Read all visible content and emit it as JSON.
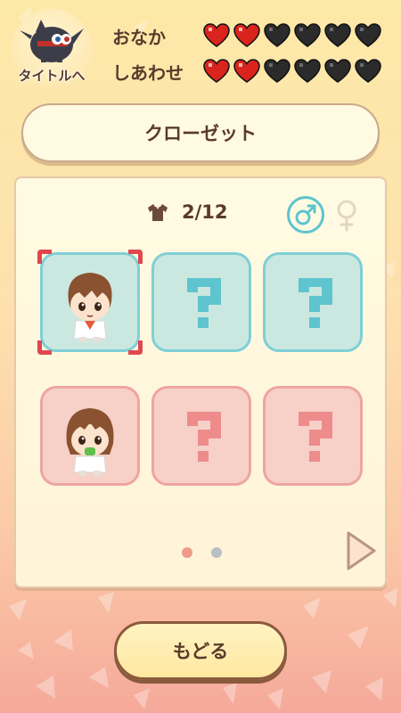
{
  "title_button": {
    "label": "タイトルへ",
    "icon": "bird-character-icon"
  },
  "stats": [
    {
      "label": "おなか",
      "filled": 2,
      "total": 6
    },
    {
      "label": "しあわせ",
      "filled": 2,
      "total": 6
    }
  ],
  "header": {
    "title": "クローゼット"
  },
  "closet": {
    "count": "2/12",
    "count_icon": "shirt-icon",
    "gender_selected": "male",
    "male_symbol": "♂",
    "female_symbol": "♀",
    "rows": [
      {
        "color": "blue",
        "slots": [
          {
            "state": "unlocked",
            "selected": true
          },
          {
            "state": "locked",
            "symbol": "?"
          },
          {
            "state": "locked",
            "symbol": "?"
          }
        ]
      },
      {
        "color": "pink",
        "slots": [
          {
            "state": "unlocked",
            "selected": false
          },
          {
            "state": "locked",
            "symbol": "?"
          },
          {
            "state": "locked",
            "symbol": "?"
          }
        ]
      }
    ],
    "page": 1,
    "page_count": 2,
    "next_icon": "triangle-right-icon"
  },
  "back_button": {
    "label": "もどる"
  },
  "colors": {
    "heart_full": "#d9241d",
    "heart_empty": "#2b2b2b",
    "blue_slot": "#cbe8e0",
    "pink_slot": "#f7d0c8",
    "accent_teal": "#5ec4ce",
    "select_red": "#e0474f"
  }
}
